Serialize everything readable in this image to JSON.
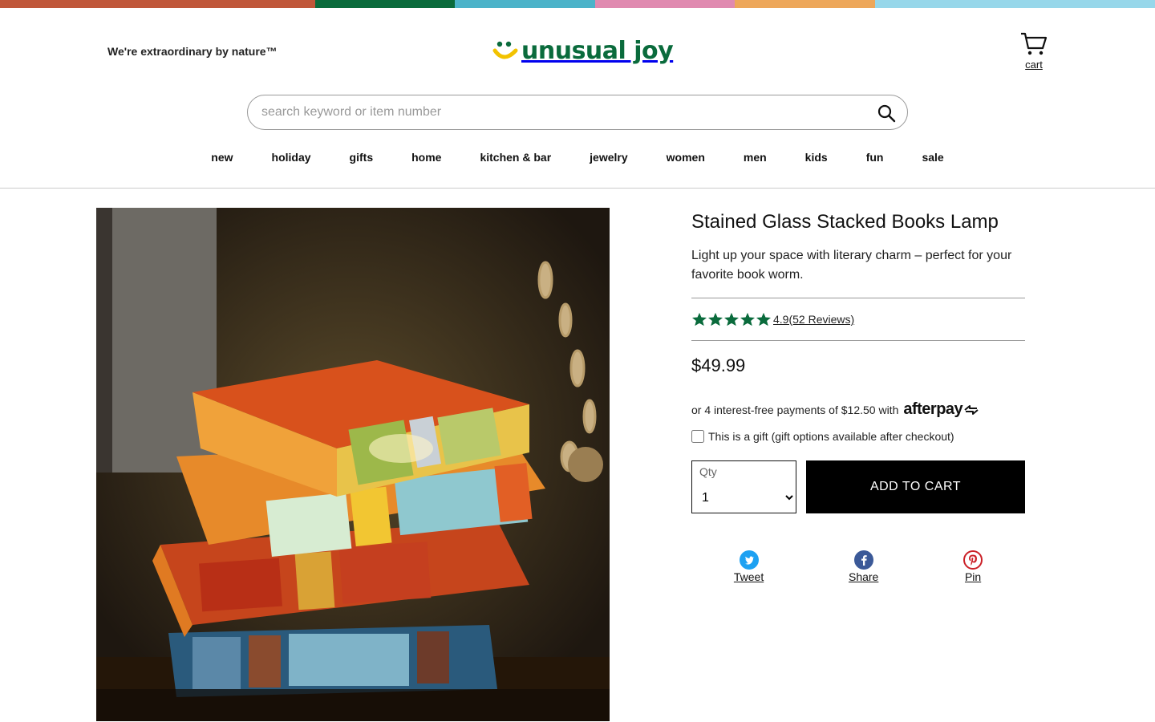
{
  "colors": {
    "stripes": [
      "#c0573a",
      "#0a6b3c",
      "#4bb3c9",
      "#e08ab0",
      "#eda75a",
      "#97d7ea"
    ],
    "brand_green": "#0a6b3c",
    "star_green": "#0a6b3c",
    "button_bg": "#000000"
  },
  "header": {
    "tagline": "We're extraordinary by nature™",
    "logo_text": "unusual joy",
    "cart_label": "cart",
    "cart_icon": "cart-icon"
  },
  "search": {
    "placeholder": "search keyword or item number",
    "icon": "search-icon"
  },
  "nav": {
    "items": [
      {
        "label": "new"
      },
      {
        "label": "holiday"
      },
      {
        "label": "gifts"
      },
      {
        "label": "home"
      },
      {
        "label": "kitchen & bar"
      },
      {
        "label": "jewelry"
      },
      {
        "label": "women"
      },
      {
        "label": "men"
      },
      {
        "label": "kids"
      },
      {
        "label": "fun"
      },
      {
        "label": "sale"
      }
    ]
  },
  "product": {
    "title": "Stained Glass Stacked Books Lamp",
    "description": "Light up your space with literary charm – perfect for your favorite book worm.",
    "rating_stars": 5,
    "rating_text": "4.9(52 Reviews)",
    "price": "$49.99",
    "afterpay_text": "or 4 interest-free payments of $12.50 with",
    "afterpay_logo": "afterpay",
    "gift_label": "This is a gift (gift options available after checkout)",
    "qty_label": "Qty",
    "qty_selected": "1",
    "add_to_cart": "ADD TO CART"
  },
  "share": {
    "tweet": "Tweet",
    "share": "Share",
    "pin": "Pin"
  }
}
